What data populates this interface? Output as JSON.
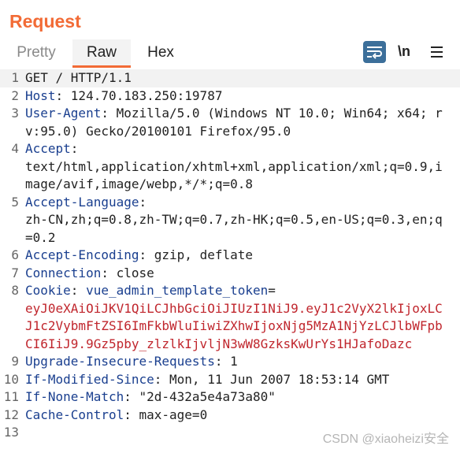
{
  "panel_title": "Request",
  "tabs": {
    "pretty": "Pretty",
    "raw": "Raw",
    "hex": "Hex"
  },
  "toolbar": {
    "newline_label": "\\n"
  },
  "lines": {
    "l1": {
      "num": "1",
      "text": "GET / HTTP/1.1"
    },
    "l2": {
      "num": "2",
      "key": "Host",
      "sep": ": ",
      "value": "124.70.183.250:19787"
    },
    "l3": {
      "num": "3",
      "key": "User-Agent",
      "sep": ": ",
      "value": "Mozilla/5.0 (Windows NT 10.0; Win64; x64; rv:95.0) Gecko/20100101 Firefox/95.0"
    },
    "l4": {
      "num": "4",
      "key": "Accept",
      "sep": ":",
      "value": "text/html,application/xhtml+xml,application/xml;q=0.9,image/avif,image/webp,*/*;q=0.8"
    },
    "l5": {
      "num": "5",
      "key": "Accept-Language",
      "sep": ":",
      "value": "zh-CN,zh;q=0.8,zh-TW;q=0.7,zh-HK;q=0.5,en-US;q=0.3,en;q=0.2"
    },
    "l6": {
      "num": "6",
      "key": "Accept-Encoding",
      "sep": ": ",
      "value": "gzip, deflate"
    },
    "l7": {
      "num": "7",
      "key": "Connection",
      "sep": ": ",
      "value": "close"
    },
    "l8": {
      "num": "8",
      "key": "Cookie",
      "sep": ": ",
      "cookie_name": "vue_admin_template_token",
      "cookie_eq": "=",
      "cookie_value": "eyJ0eXAiOiJKV1QiLCJhbGciOiJIUzI1NiJ9.eyJ1c2VyX2lkIjoxLCJ1c2VybmFtZSI6ImFkbWluIiwiZXhwIjoxNjg5MzA1NjYzLCJlbWFpbCI6IiJ9.9Gz5pby_zlzlkIjvljN3wW8GzksKwUrYs1HJafoDazc"
    },
    "l9": {
      "num": "9",
      "key": "Upgrade-Insecure-Requests",
      "sep": ": ",
      "value": "1"
    },
    "l10": {
      "num": "10",
      "key": "If-Modified-Since",
      "sep": ": ",
      "value": "Mon, 11 Jun 2007 18:53:14 GMT"
    },
    "l11": {
      "num": "11",
      "key": "If-None-Match",
      "sep": ": ",
      "value": "\"2d-432a5e4a73a80\""
    },
    "l12": {
      "num": "12",
      "key": "Cache-Control",
      "sep": ": ",
      "value": "max-age=0"
    },
    "l13": {
      "num": "13"
    }
  },
  "watermark": "CSDN @xiaoheizi安全",
  "colors": {
    "accent": "#f26b36",
    "header_key": "#1a3f8f",
    "cookie": "#c0262d",
    "wrap_button": "#3c6f9a"
  },
  "icons": {
    "wrap": "wrap-lines-icon",
    "menu": "hamburger-menu-icon"
  }
}
